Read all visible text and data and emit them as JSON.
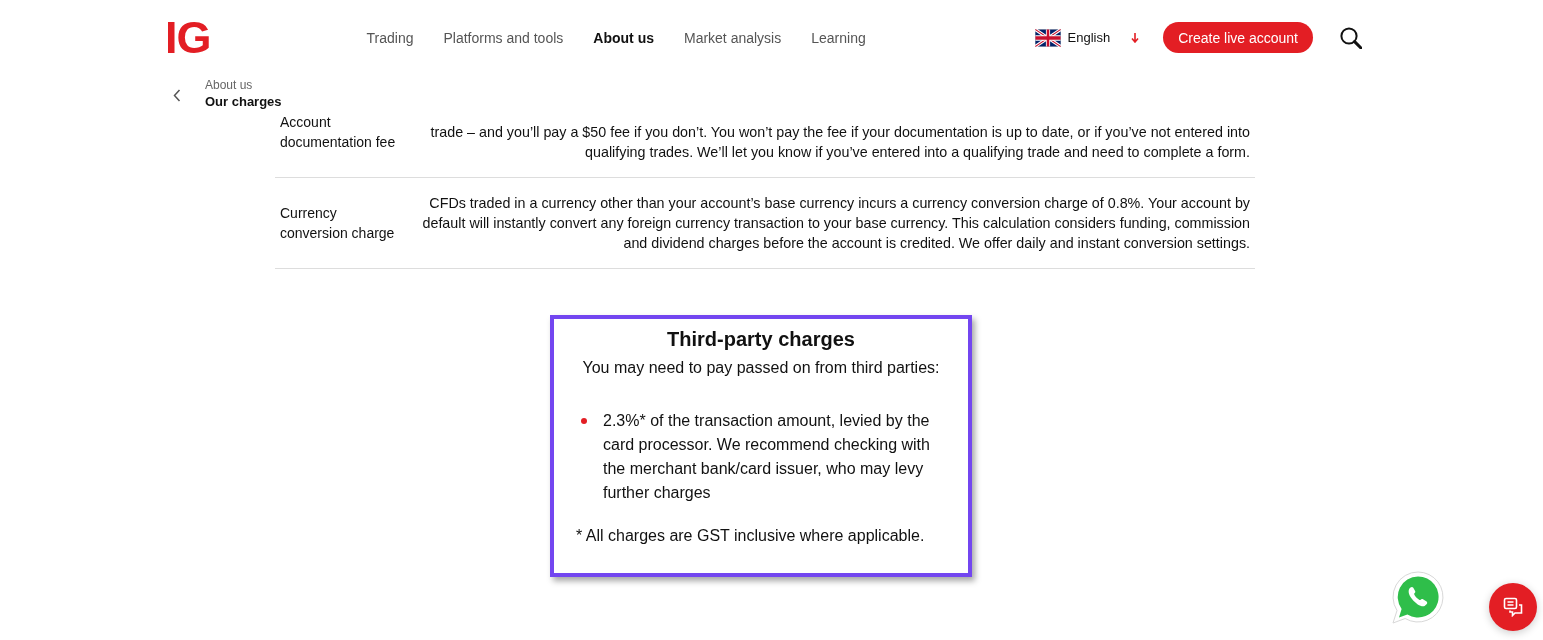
{
  "header": {
    "logo": "IG",
    "nav": [
      {
        "label": "Trading",
        "selected": false
      },
      {
        "label": "Platforms and tools",
        "selected": false
      },
      {
        "label": "About us",
        "selected": true
      },
      {
        "label": "Market analysis",
        "selected": false
      },
      {
        "label": "Learning",
        "selected": false
      }
    ],
    "language": "English",
    "cta_button": "Create live account"
  },
  "breadcrumb": {
    "parent": "About us",
    "current": "Our charges"
  },
  "charges": [
    {
      "label": "Account\ndocumentation fee",
      "description": "trade – and you’ll pay a $50 fee if you don’t. You won’t pay the fee if your documentation is up to date, or if you’ve not entered into\nqualifying trades. We’ll let you know if you’ve entered into a qualifying trade and need to complete a form."
    },
    {
      "label": "Currency\nconversion charge",
      "description": "CFDs traded in a currency other than your account’s base currency incurs a currency conversion charge of 0.8%. Your account by\ndefault will instantly convert any foreign currency transaction to your base currency. This calculation considers funding, commission\nand dividend charges before the account is credited. We offer daily and instant conversion settings."
    }
  ],
  "third_party": {
    "title": "Third-party charges",
    "intro": "You may need to pay passed on from third parties:",
    "items": [
      "2.3%* of the transaction amount, levied by the card processor. We recommend checking with the merchant bank/card issuer, who may levy further charges"
    ],
    "footnote": "* All charges are GST inclusive where applicable."
  }
}
